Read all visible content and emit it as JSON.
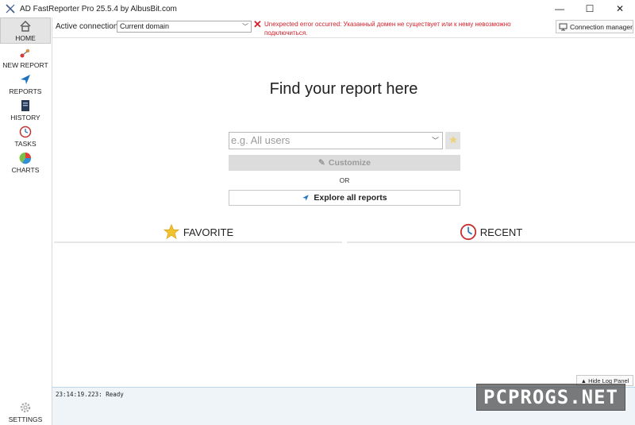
{
  "window": {
    "title": "AD FastReporter Pro 25.5.4 by AlbusBit.com",
    "controls": {
      "minimize": "—",
      "maximize": "☐",
      "close": "✕"
    }
  },
  "sidebar": {
    "items": [
      {
        "label": "HOME",
        "icon": "home-icon",
        "active": true
      },
      {
        "label": "NEW REPORT",
        "icon": "new-report-icon",
        "active": false
      },
      {
        "label": "REPORTS",
        "icon": "reports-icon",
        "active": false
      },
      {
        "label": "HISTORY",
        "icon": "history-icon",
        "active": false
      },
      {
        "label": "TASKS",
        "icon": "tasks-icon",
        "active": false
      },
      {
        "label": "CHARTS",
        "icon": "charts-icon",
        "active": false
      }
    ],
    "settings_label": "SETTINGS"
  },
  "connection": {
    "label": "Active connection:",
    "selected": "Current domain",
    "error_icon": "✕",
    "error_text": "Unexpected error occurred: Указанный домен не существует или к нему невозможно подключиться.",
    "manager_label": "Connection manager"
  },
  "main": {
    "heading": "Find your report here",
    "search_placeholder": "e.g. All users",
    "customize_label": "Customize",
    "or_text": "OR",
    "explore_label": "Explore all reports",
    "favorite_label": "FAVORITE",
    "recent_label": "RECENT"
  },
  "log": {
    "hide_label": "Hide Log Panel",
    "hide_arrow": "▲",
    "lines": [
      "23:14:19.223: Ready"
    ]
  },
  "watermark": "PCPROGS.NET",
  "colors": {
    "error": "#d4202a",
    "accent_blue": "#1e73be",
    "star": "#f2c12e"
  }
}
